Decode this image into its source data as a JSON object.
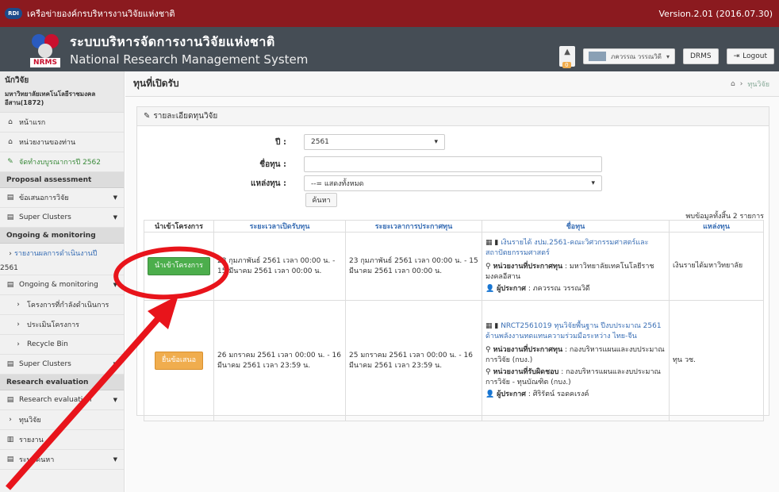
{
  "topbar": {
    "network_name": "เครือข่ายองค์กรบริหารงานวิจัยแห่งชาติ",
    "logo_text": "RDI",
    "version": "Version.2.01 (2016.07.30)"
  },
  "header": {
    "title_th": "ระบบบริหารจัดการงานวิจัยแห่งชาติ",
    "title_en": "National Research Management System",
    "logo_text": "NRMS",
    "notif_count": "0",
    "user_name": "ภควรรณ วรรณวิดี",
    "drms_label": "DRMS",
    "logout_label": "Logout"
  },
  "sidebar": {
    "role": "นักวิจัย",
    "org": "มหาวิทยาลัยเทคโนโลยีราชมงคล อีสาน(1872)",
    "items": [
      {
        "label": "หน้าแรก",
        "icon": "home-icon"
      },
      {
        "label": "หน่วยงานของท่าน",
        "icon": "home-icon"
      },
      {
        "label": "จัดทำงบบูรณาการปี 2562",
        "icon": "wrench-icon"
      }
    ],
    "sec1": "Proposal assessment",
    "p_items": [
      "ข้อเสนอการวิจัย",
      "Super Clusters"
    ],
    "sec2": "Ongoing & monitoring",
    "report_item": "รายงานผลการดำเนินงานปี",
    "report_year": "2561",
    "o_items": [
      "Ongoing & monitoring"
    ],
    "o_subs": [
      "โครงการที่กำลังดำเนินการ",
      "ประเมินโครงการ",
      "Recycle Bin"
    ],
    "o_super": "Super Clusters",
    "sec3": "Research evaluation",
    "r_items": [
      "Research evaluation"
    ],
    "fund_item": "ทุนวิจัย",
    "report_menu": "รายงาน",
    "search_menu": "ระบบค้นหา"
  },
  "main": {
    "title": "ทุนที่เปิดรับ",
    "breadcrumb": "ทุนวิจัย",
    "panel_title": "รายละเอียดทุนวิจัย",
    "form": {
      "year_label": "ปี :",
      "year_value": "2561",
      "name_label": "ชื่อทุน :",
      "name_value": "",
      "source_label": "แหล่งทุน :",
      "source_value": "--= แสดงทั้งหมด",
      "search_btn": "ค้นหา"
    },
    "count_text": "พบข้อมูลทั้งสิ้น 2 รายการ",
    "columns": [
      "นำเข้าโครงการ",
      "ระยะเวลาเปิดรับทุน",
      "ระยะเวลาการประกาศทุน",
      "ชื่อทุน",
      "แหล่งทุน"
    ],
    "rows": [
      {
        "button": "นำเข้าโครงการ",
        "open_period": "23 กุมภาพันธ์ 2561 เวลา 00:00 น. - 15 มีนาคม 2561 เวลา 00:00 น.",
        "announce_period": "23 กุมภาพันธ์ 2561 เวลา 00:00 น. - 15 มีนาคม 2561 เวลา 00:00 น.",
        "fund_name": "เงินรายได้ งปม.2561-คณะวิศวกรรมศาสตร์และสถาปัตยกรรมศาสตร์",
        "agency_label": "หน่วยงานที่ประกาศทุน",
        "agency_value": ": มหาวิทยาลัยเทคโนโลยีราชมงคลอีสาน",
        "announcer_label": "ผู้ประกาศ",
        "announcer_value": ": ภควรรณ วรรณวิดี",
        "source": "เงินรายได้มหาวิทยาลัย"
      },
      {
        "button": "ยื่นข้อเสนอ",
        "open_period": "26 มกราคม 2561 เวลา 00:00 น. - 16 มีนาคม 2561 เวลา 23:59 น.",
        "announce_period": "25 มกราคม 2561 เวลา 00:00 น. - 16 มีนาคม 2561 เวลา 23:59 น.",
        "fund_name": "NRCT2561019 ทุนวิจัยพื้นฐาน ปีงบประมาณ 2561 ด้านพลังงานทดแทนความร่วมมือระหว่าง ไทย-จีน",
        "agency_label": "หน่วยงานที่ประกาศทุน",
        "agency_value": ": กองบริหารแผนและงบประมาณการวิจัย (กบง.)",
        "resp_label": "หน่วยงานที่รับผิดชอบ",
        "resp_value": ": กองบริหารแผนและงบประมาณการวิจัย - ทุนบัณฑิต (กบง.)",
        "announcer_label": "ผู้ประกาศ",
        "announcer_value": ": ศิริรัตน์ รอดคเรงค์",
        "source": "ทุน วช."
      }
    ]
  },
  "colors": {
    "topbar": "#8b1a1f",
    "header": "#454d55",
    "green": "#4cae4c",
    "orange": "#f0ad4e",
    "annotation": "#e8141b"
  }
}
